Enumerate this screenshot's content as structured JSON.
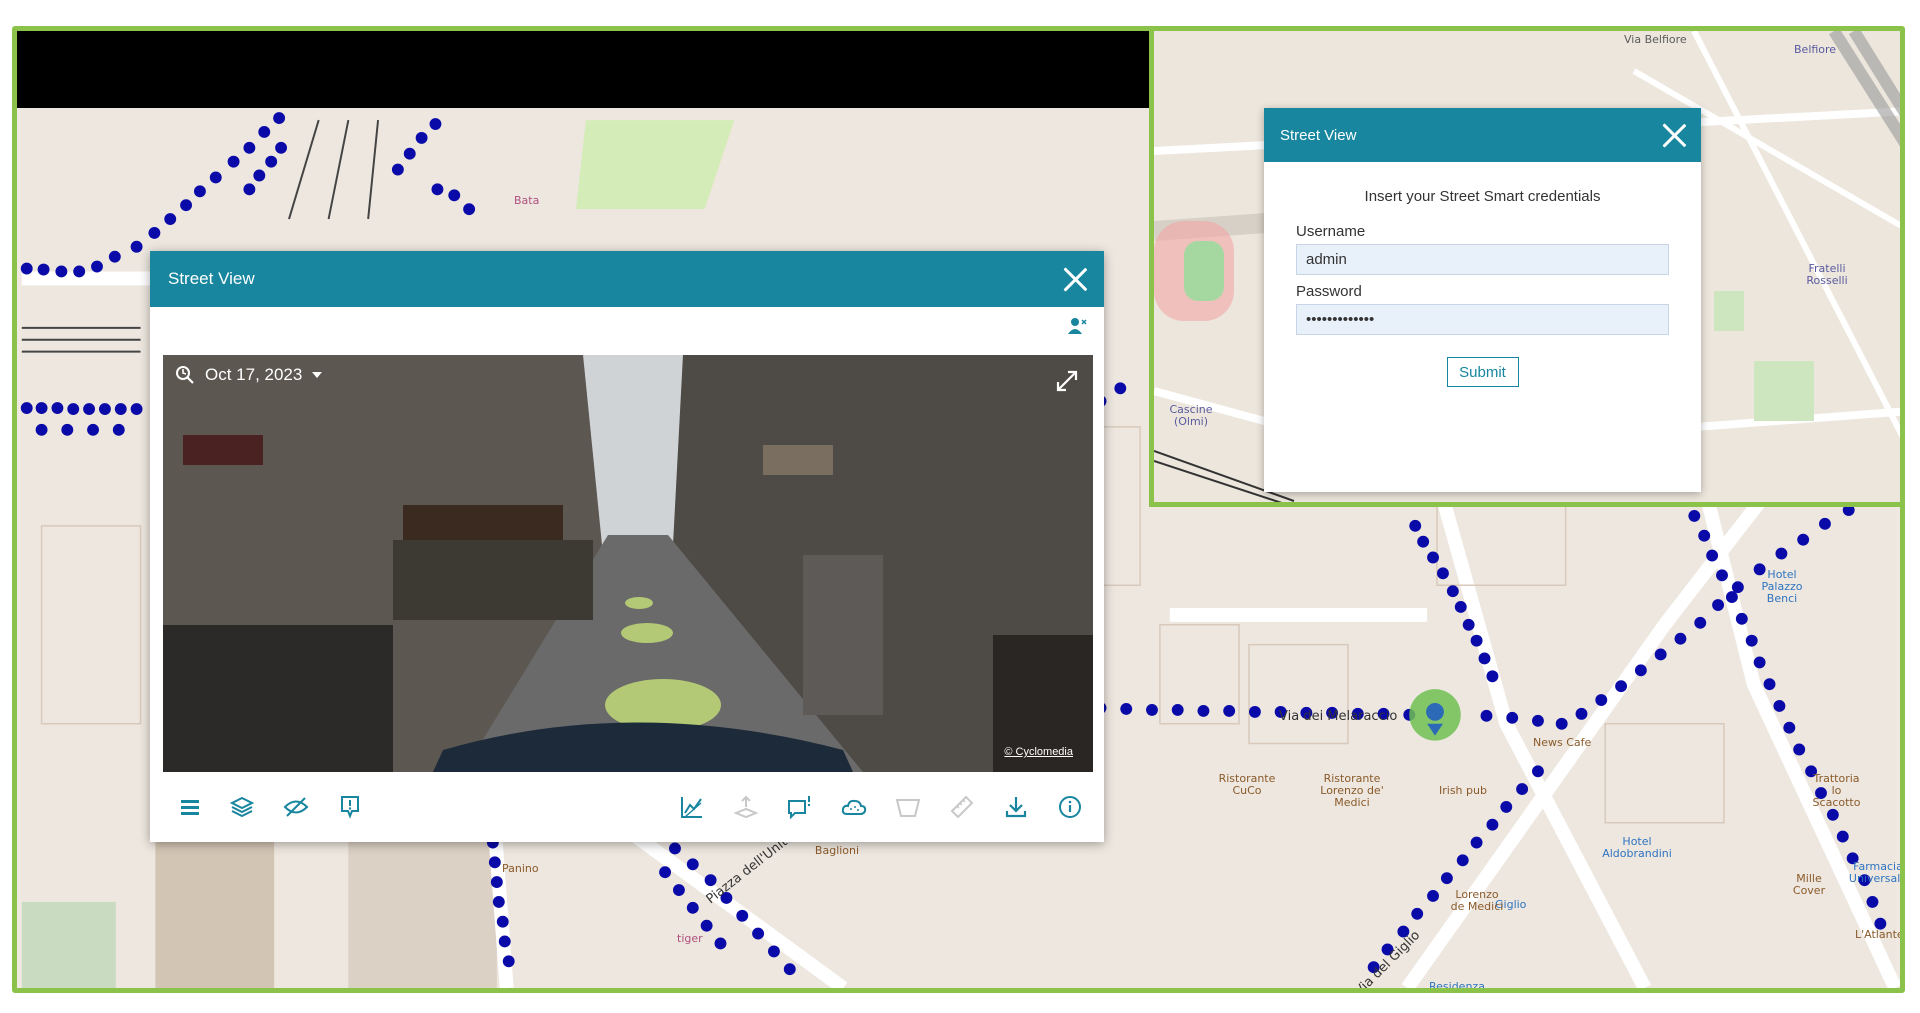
{
  "street_view": {
    "title": "Street View",
    "date": "Oct 17, 2023",
    "copyright": "© Cyclomedia",
    "toolbar_left": [
      "menu-icon",
      "layers-icon",
      "hide-icon",
      "report-icon"
    ],
    "toolbar_right": [
      "surface-icon",
      "height-icon",
      "comment-icon",
      "cloud-icon",
      "area-icon",
      "ruler-icon",
      "download-icon",
      "info-icon"
    ]
  },
  "login": {
    "title": "Street View",
    "intro": "Insert your Street Smart credentials",
    "username_label": "Username",
    "username_value": "admin",
    "password_label": "Password",
    "password_value": "•••••••••••••",
    "submit_label": "Submit"
  },
  "map_labels": {
    "via_dei_melaraccio": "Via dei Melaraccio",
    "piazza": "Piazza dell'Unità",
    "via_del_giglio": "Via del Giglio",
    "ristorante_cuco": "Ristorante CuCo",
    "ristorante_lorenzo": "Ristorante Lorenzo de' Medici",
    "irish_pub": "Irish pub",
    "grand_hotel": "Grand Hotel Baglioni",
    "hotel_aldobrandini": "Hotel Aldobrandini",
    "hotel_palazzo_benci": "Hotel Palazzo Benci",
    "trattoria": "Trattoria lo Scacotto",
    "farmacia": "Farmacia Universale",
    "mille_cover": "Mille Cover",
    "latlante": "L'Atlante",
    "giglio": "Giglio",
    "lorenzo_medici": "Lorenzo de Medici",
    "residenza": "Residenza",
    "news_cafe": "News Cafe",
    "panino": "Panino",
    "tiger": "tiger",
    "bata": "Bata",
    "cascine": "Cascine (Olmi)",
    "fratelli_rosselli": "Fratelli Rosselli",
    "belfiore": "Belfiore",
    "via_belfiore": "Via Belfiore"
  },
  "colors": {
    "header": "#17869e",
    "frame": "#8bc34a",
    "dots": "#0a0aa8"
  }
}
